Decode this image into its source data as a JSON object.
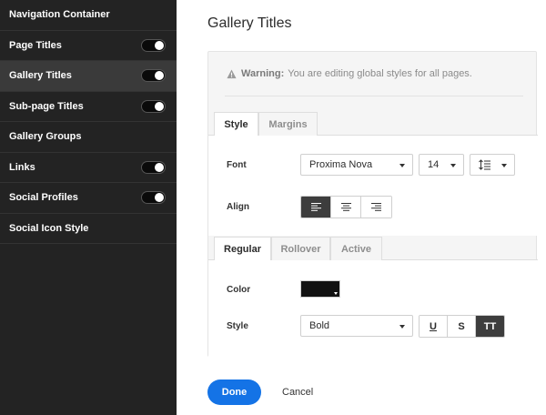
{
  "sidebar": {
    "items": [
      {
        "label": "Navigation Container",
        "toggle": false
      },
      {
        "label": "Page Titles",
        "toggle": true,
        "on": true
      },
      {
        "label": "Gallery Titles",
        "toggle": true,
        "on": true,
        "active": true
      },
      {
        "label": "Sub-page Titles",
        "toggle": true,
        "on": true
      },
      {
        "label": "Gallery Groups",
        "toggle": false
      },
      {
        "label": "Links",
        "toggle": true,
        "on": true
      },
      {
        "label": "Social Profiles",
        "toggle": true,
        "on": true
      },
      {
        "label": "Social Icon Style",
        "toggle": false
      }
    ]
  },
  "main": {
    "title": "Gallery Titles",
    "warning": {
      "bold": "Warning:",
      "text": "You are editing global styles for all pages."
    },
    "tabs1": [
      {
        "label": "Style",
        "active": true
      },
      {
        "label": "Margins",
        "active": false
      }
    ],
    "font": {
      "label": "Font",
      "family": "Proxima Nova",
      "size": "14",
      "line_height_icon": "line-height-icon"
    },
    "align": {
      "label": "Align",
      "options": [
        "align-left-icon",
        "align-center-icon",
        "align-right-icon"
      ],
      "selected": 0
    },
    "tabs2": [
      {
        "label": "Regular",
        "active": true
      },
      {
        "label": "Rollover",
        "active": false
      },
      {
        "label": "Active",
        "active": false
      }
    ],
    "color": {
      "label": "Color",
      "value": "#111111"
    },
    "style": {
      "label": "Style",
      "weight": "Bold",
      "buttons": [
        {
          "label": "U",
          "on": false
        },
        {
          "label": "S",
          "on": false
        },
        {
          "label": "TT",
          "on": true
        }
      ]
    }
  },
  "footer": {
    "done_label": "Done",
    "cancel_label": "Cancel"
  },
  "colors": {
    "accent": "#1473e6",
    "sidebar_bg": "#232323",
    "sidebar_active": "#3a3a3a"
  }
}
